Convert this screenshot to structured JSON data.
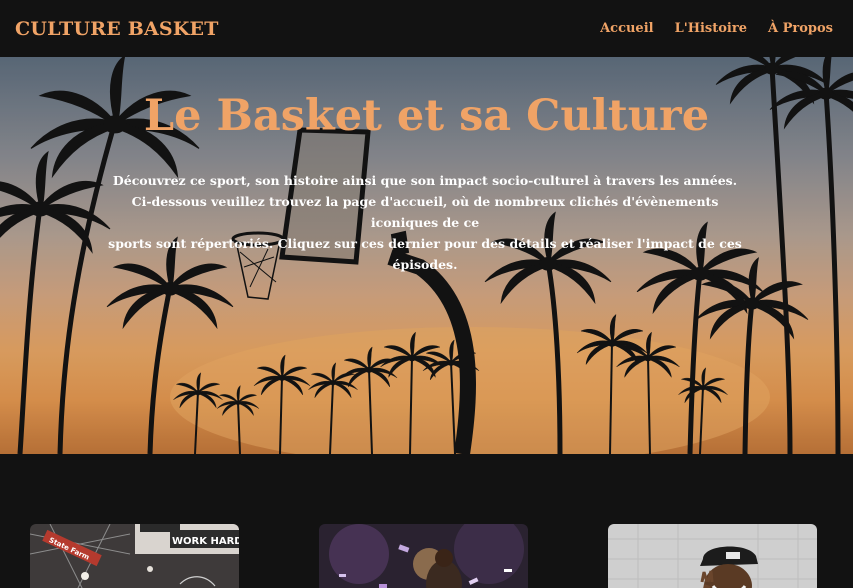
{
  "navbar": {
    "brand": "CULTURE BASKET",
    "links": [
      {
        "label": "Accueil"
      },
      {
        "label": "L'Histoire"
      },
      {
        "label": "À Propos"
      }
    ]
  },
  "hero": {
    "title": "Le Basket et sa Culture",
    "lines": [
      "Découvrez ce sport, son histoire ainsi que son impact socio-culturel à travers les années.",
      "Ci-dessous veuillez trouvez la page d'accueil, où de nombreux clichés d'évènements iconiques de ce",
      "sports sont répertoriés. Cliquez sur ces dernier pour des détails et réaliser l'impact de ces épisodes."
    ]
  },
  "cards": [
    {
      "name": "card-arena",
      "sign_text": "WORK HARD",
      "banner_text": "State Farm"
    },
    {
      "name": "card-celebration"
    },
    {
      "name": "card-player"
    }
  ],
  "colors": {
    "accent": "#f0a366",
    "background": "#121212",
    "text": "#ffffff"
  }
}
